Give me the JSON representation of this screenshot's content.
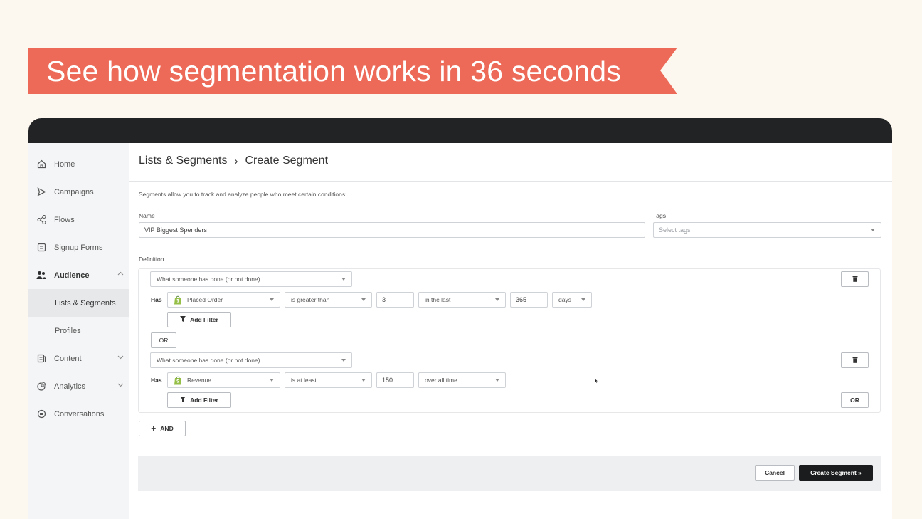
{
  "banner": {
    "text": "See how segmentation works in 36 seconds",
    "color": "#ec6a57"
  },
  "sidebar": {
    "items": [
      {
        "label": "Home",
        "icon": "home-icon"
      },
      {
        "label": "Campaigns",
        "icon": "send-icon"
      },
      {
        "label": "Flows",
        "icon": "flows-icon"
      },
      {
        "label": "Signup Forms",
        "icon": "form-icon"
      },
      {
        "label": "Audience",
        "icon": "people-icon"
      },
      {
        "label": "Lists & Segments"
      },
      {
        "label": "Profiles"
      },
      {
        "label": "Content",
        "icon": "content-icon"
      },
      {
        "label": "Analytics",
        "icon": "analytics-icon"
      },
      {
        "label": "Conversations",
        "icon": "chat-icon"
      }
    ]
  },
  "breadcrumb": {
    "parent": "Lists & Segments",
    "separator": "›",
    "current": "Create Segment"
  },
  "description": "Segments allow you to track and analyze people who meet certain conditions:",
  "form": {
    "name_label": "Name",
    "name_value": "VIP Biggest Spenders",
    "tags_label": "Tags",
    "tags_placeholder": "Select tags",
    "definition_label": "Definition"
  },
  "conditions": [
    {
      "type": "What someone has done (or not done)",
      "has": "Has",
      "metric": "Placed Order",
      "operator": "is greater than",
      "value": "3",
      "timeframe": "in the last",
      "period_value": "365",
      "period_unit": "days",
      "add_filter": "Add Filter"
    },
    {
      "type": "What someone has done (or not done)",
      "has": "Has",
      "metric": "Revenue",
      "operator": "is at least",
      "value": "150",
      "timeframe": "over all time",
      "add_filter": "Add Filter"
    }
  ],
  "or_label": "OR",
  "and_label": "AND",
  "actions": {
    "cancel": "Cancel",
    "create": "Create Segment »"
  }
}
